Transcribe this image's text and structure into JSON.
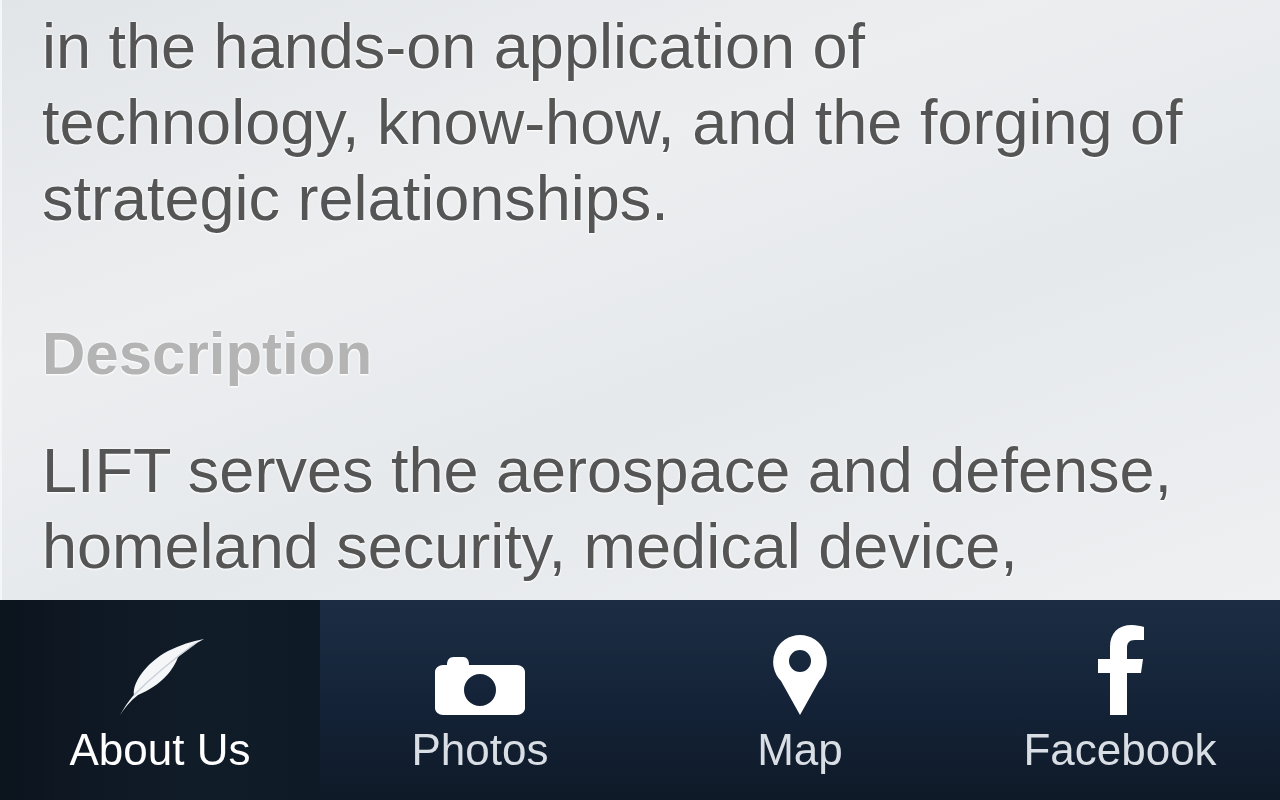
{
  "article": {
    "intro": {
      "lines": [
        "in the hands-on application of",
        "technology, know-how, and the forging of",
        "strategic relationships."
      ]
    },
    "sections": [
      {
        "heading": "Description",
        "lines": [
          "LIFT serves the aerospace and defense,",
          "homeland security, medical device,"
        ]
      }
    ]
  },
  "tab_bar": {
    "tabs": [
      {
        "label": "About Us",
        "selected": true
      },
      {
        "label": "Photos",
        "selected": false
      },
      {
        "label": "Map",
        "selected": false
      },
      {
        "label": "Facebook",
        "selected": false
      }
    ]
  }
}
